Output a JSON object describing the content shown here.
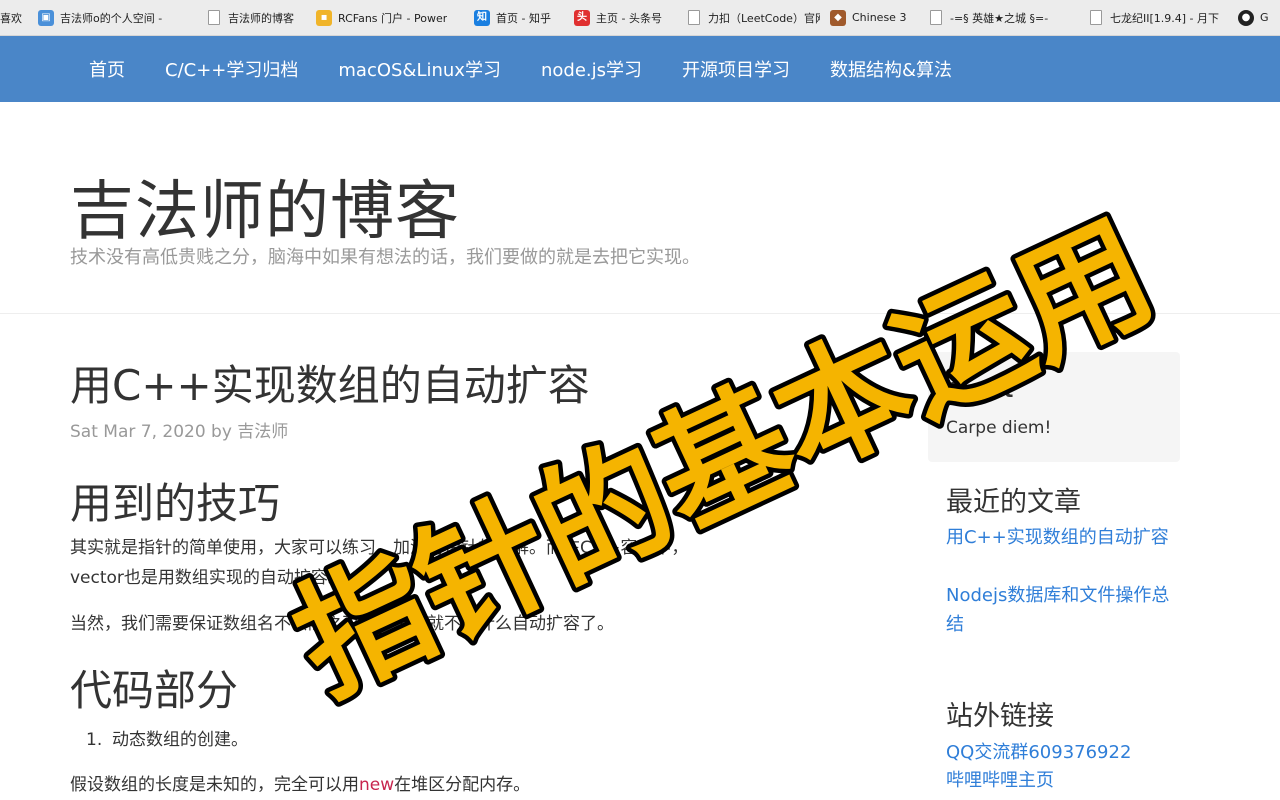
{
  "bookmarks": [
    {
      "label": "喜欢",
      "icon": "bookmark-star-icon"
    },
    {
      "label": "吉法师o的个人空间 -",
      "icon": "bilibili-icon"
    },
    {
      "label": "吉法师的博客",
      "icon": "page-icon"
    },
    {
      "label": "RCFans 门户 - Power",
      "icon": "folder-icon"
    },
    {
      "label": "首页 - 知乎",
      "icon": "zhihu-icon"
    },
    {
      "label": "主页 - 头条号",
      "icon": "toutiao-icon"
    },
    {
      "label": "力扣（LeetCode）官网",
      "icon": "page-icon"
    },
    {
      "label": "Chinese 3",
      "icon": "game-icon"
    },
    {
      "label": "-=§ 英雄★之城 §=-",
      "icon": "page-icon"
    },
    {
      "label": "七龙纪II[1.9.4] - 月下",
      "icon": "page-icon"
    },
    {
      "label": "G",
      "icon": "github-icon"
    }
  ],
  "nav": {
    "items": [
      "首页",
      "C/C++学习归档",
      "macOS&Linux学习",
      "node.js学习",
      "开源项目学习",
      "数据结构&算法"
    ]
  },
  "site": {
    "title": "吉法师的博客",
    "tagline": "技术没有高低贵贱之分，脑海中如果有想法的话，我们要做的就是去把它实现。"
  },
  "post": {
    "title": "用C++实现数组的自动扩容",
    "meta": "Sat Mar 7, 2020 by 吉法师",
    "section1_heading": "用到的技巧",
    "para1_line1": "其实就是指针的简单使用，大家可以练习，加深对指针的理解。而在C++容器中，",
    "para1_line2": "vector也是用数组实现的自动扩容。",
    "para2": "当然，我们需要保证数组名不会随之改变，不然就不算什么自动扩容了。",
    "section2_heading": "代码部分",
    "list_item_number": "1.",
    "list_item_text": "动态数组的创建。",
    "para3_before": "假设数组的长度是未知的，完全可以用",
    "para3_keyword": "new",
    "para3_after": "在堆区分配内存。"
  },
  "sidebar": {
    "about_heading": "About",
    "about_text": "Carpe diem!",
    "recent_heading": "最近的文章",
    "recent_links": [
      "用C++实现数组的自动扩容",
      "Nodejs数据库和文件操作总结"
    ],
    "external_heading": "站外链接",
    "external_links": [
      "QQ交流群609376922",
      "哔哩哔哩主页"
    ]
  },
  "overlay": {
    "caption": "指针的基本运用",
    "fill_color": "#f5b400",
    "stroke_color": "#000000"
  },
  "colors": {
    "nav_bg": "#4a86c8",
    "link": "#2f7ed8",
    "keyword": "#c7254e"
  }
}
